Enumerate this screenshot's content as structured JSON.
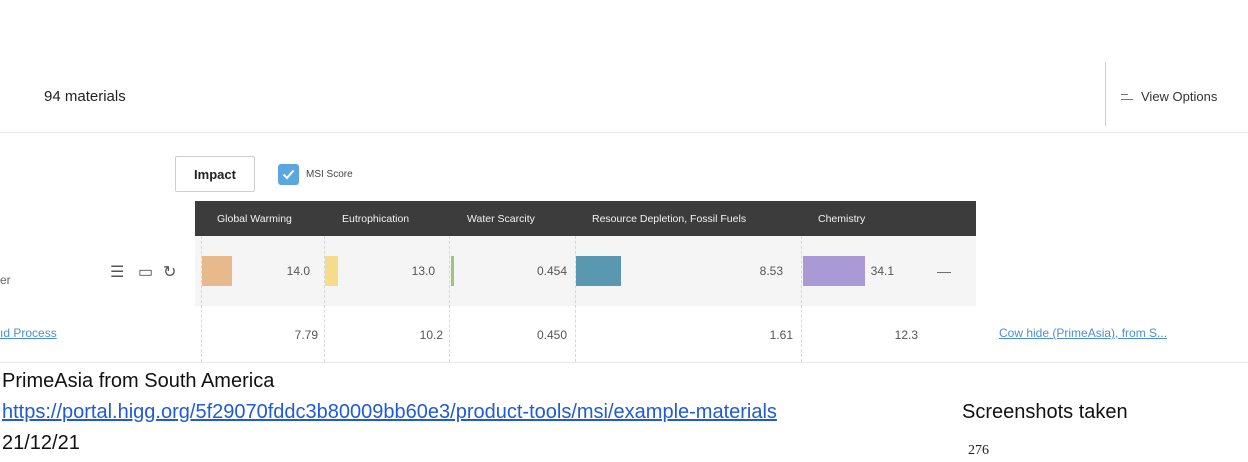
{
  "toolbar": {
    "material_count": "94 materials",
    "view_options_label": "View Options"
  },
  "controls": {
    "impact_label": "Impact",
    "msi_label": "MSI Score",
    "msi_checked": true,
    "msi_color": "#5aa7df"
  },
  "table": {
    "columns": [
      "Global Warming",
      "Eutrophication",
      "Water Scarcity",
      "Resource Depletion, Fossil Fuels",
      "Chemistry"
    ],
    "row1": {
      "label_fragment": "er",
      "values": [
        "14.0",
        "13.0",
        "0.454",
        "8.53",
        "34.1"
      ],
      "bar_colors": [
        "#e8b98a",
        "#f4dc8c",
        "#9fc57a",
        "#5a97b0",
        "#a99ad6"
      ],
      "trailing": "—"
    },
    "row2": {
      "link_left": "ıd Process",
      "values": [
        "7.79",
        "10.2",
        "0.450",
        "1.61",
        "12.3"
      ],
      "link_right": "Cow hide (PrimeAsia), from S..."
    }
  },
  "caption": {
    "line1": "PrimeAsia from South America",
    "url": "https://portal.higg.org/5f29070fddc3b80009bb60e3/product-tools/msi/example-materials",
    "screenshots": "Screenshots taken",
    "date": "21/12/21",
    "page_number": "276"
  },
  "icons": [
    "view-options-icon",
    "checkmark-icon",
    "sliders-icon",
    "save-icon",
    "reset-icon"
  ]
}
